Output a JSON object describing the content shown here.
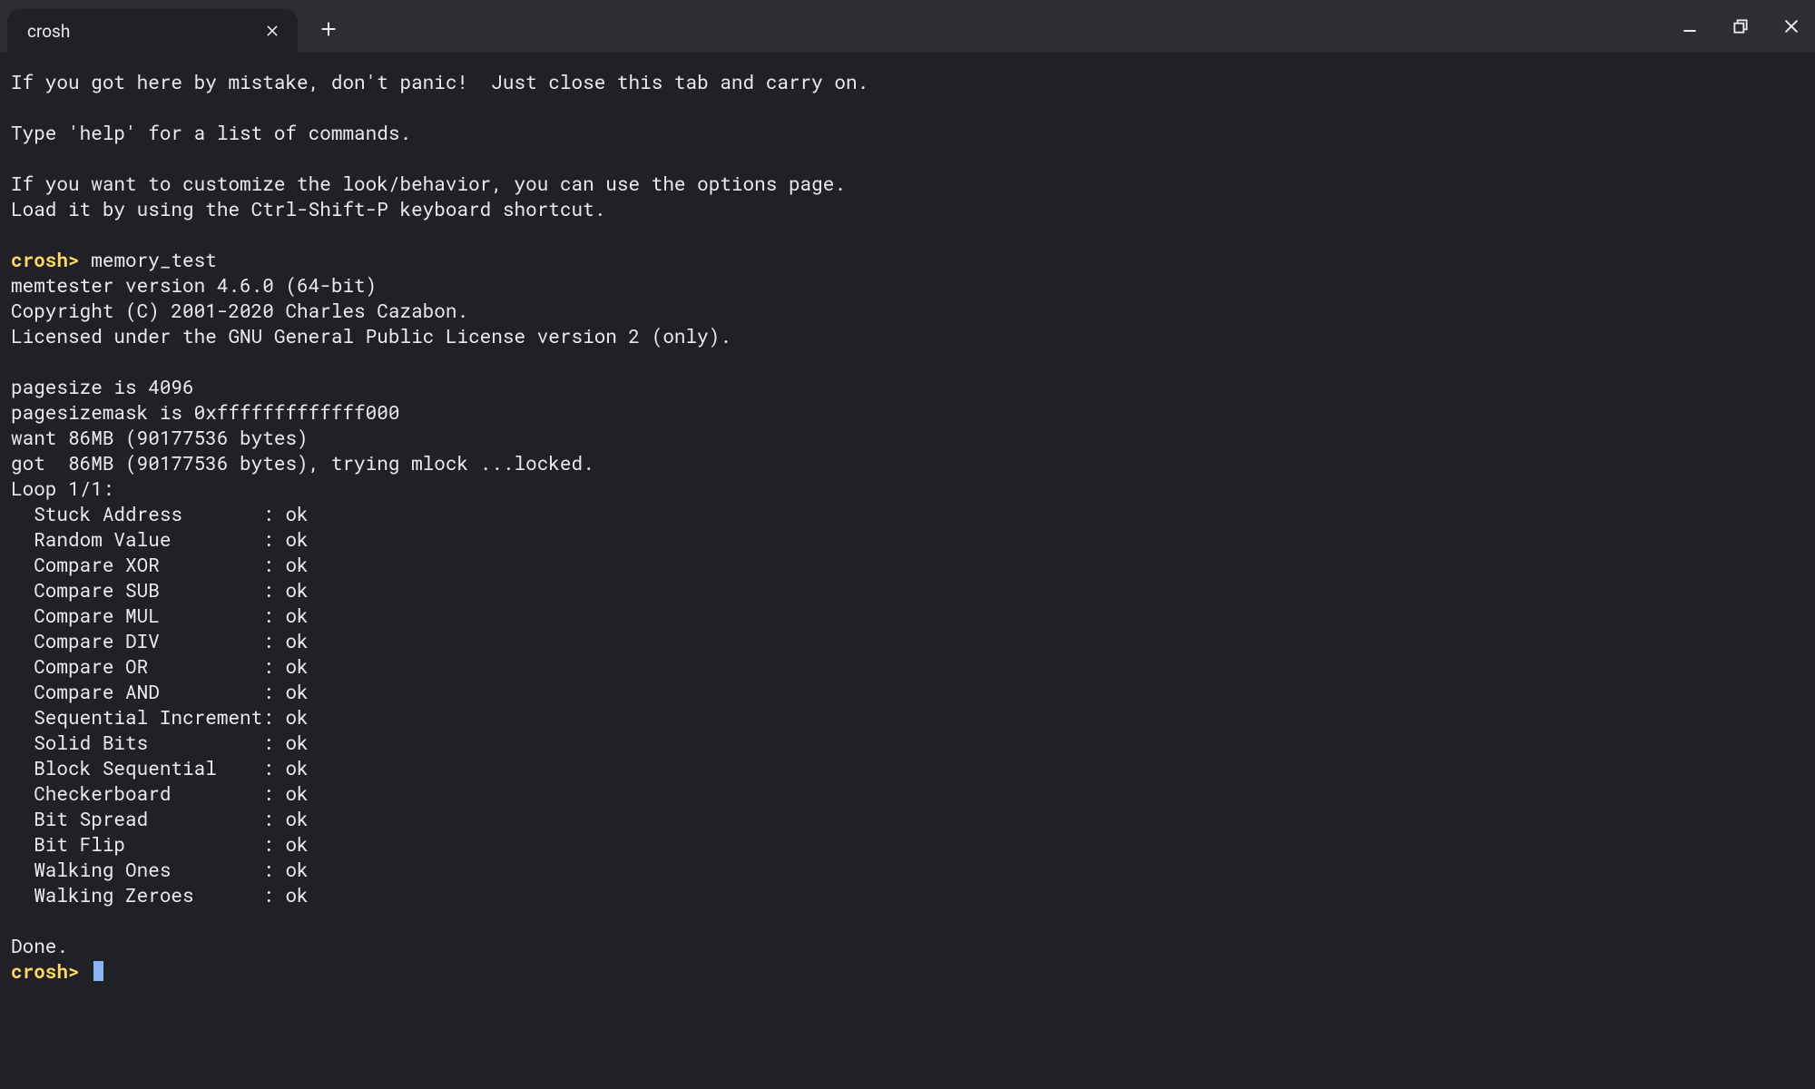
{
  "colors": {
    "bg": "#202124",
    "titlebar": "#2d2e31",
    "text": "#e8eaed",
    "prompt": "#fdd663",
    "cursor": "#8ab4f8"
  },
  "tab": {
    "title": "crosh"
  },
  "intro": {
    "line1": "If you got here by mistake, don't panic!  Just close this tab and carry on.",
    "line2": "Type 'help' for a list of commands.",
    "line3": "If you want to customize the look/behavior, you can use the options page.",
    "line4": "Load it by using the Ctrl-Shift-P keyboard shortcut."
  },
  "prompt_label": "crosh>",
  "command": "memory_test",
  "memtester": {
    "version_line": "memtester version 4.6.0 (64-bit)",
    "copyright": "Copyright (C) 2001-2020 Charles Cazabon.",
    "license": "Licensed under the GNU General Public License version 2 (only).",
    "pagesize": "pagesize is 4096",
    "pagesizemask": "pagesizemask is 0xfffffffffffff000",
    "want": "want 86MB (90177536 bytes)",
    "got": "got  86MB (90177536 bytes), trying mlock ...locked.",
    "loop": "Loop 1/1:"
  },
  "tests": [
    {
      "name": "Stuck Address",
      "status": "ok"
    },
    {
      "name": "Random Value",
      "status": "ok"
    },
    {
      "name": "Compare XOR",
      "status": "ok"
    },
    {
      "name": "Compare SUB",
      "status": "ok"
    },
    {
      "name": "Compare MUL",
      "status": "ok"
    },
    {
      "name": "Compare DIV",
      "status": "ok"
    },
    {
      "name": "Compare OR",
      "status": "ok"
    },
    {
      "name": "Compare AND",
      "status": "ok"
    },
    {
      "name": "Sequential Increment",
      "status": "ok"
    },
    {
      "name": "Solid Bits",
      "status": "ok"
    },
    {
      "name": "Block Sequential",
      "status": "ok"
    },
    {
      "name": "Checkerboard",
      "status": "ok"
    },
    {
      "name": "Bit Spread",
      "status": "ok"
    },
    {
      "name": "Bit Flip",
      "status": "ok"
    },
    {
      "name": "Walking Ones",
      "status": "ok"
    },
    {
      "name": "Walking Zeroes",
      "status": "ok"
    }
  ],
  "done": "Done."
}
